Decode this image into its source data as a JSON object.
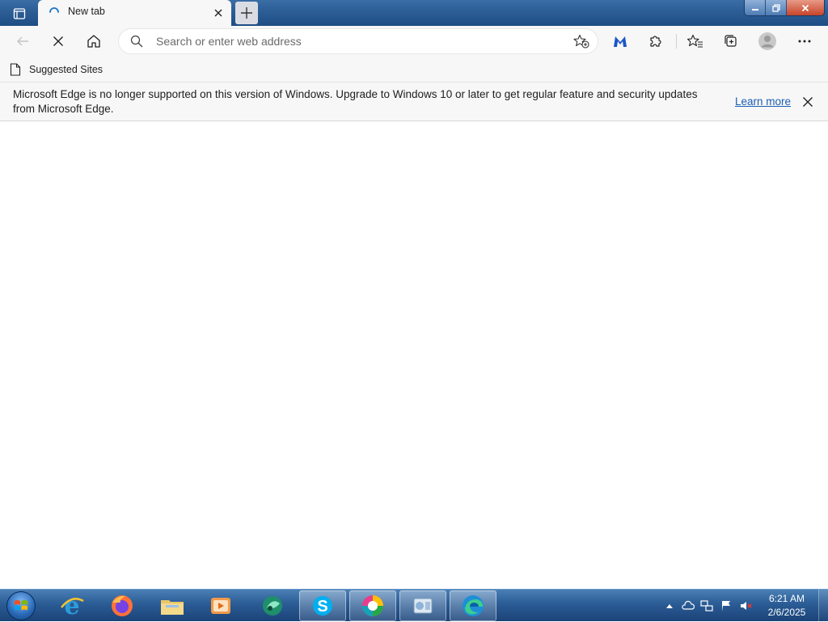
{
  "tab": {
    "title": "New tab",
    "state": "loading"
  },
  "address_bar": {
    "placeholder": "Search or enter web address",
    "value": ""
  },
  "favorites_bar": {
    "items": [
      {
        "label": "Suggested Sites",
        "icon": "page-icon"
      }
    ]
  },
  "infobar": {
    "message": "Microsoft Edge is no longer supported on this version of Windows. Upgrade to Windows 10 or later to get regular feature and security updates from Microsoft Edge.",
    "link": "Learn more"
  },
  "toolbar_icons": [
    "back-icon",
    "stop-icon",
    "home-icon",
    "favorites-add-icon",
    "malwarebytes-icon",
    "extensions-icon",
    "favorites-icon",
    "collections-icon",
    "profile-icon",
    "more-icon"
  ],
  "taskbar": {
    "apps": [
      "internet-explorer-icon",
      "firefox-icon",
      "file-explorer-icon",
      "media-player-icon",
      "app-icon",
      "skype-icon",
      "color-app-icon",
      "control-panel-icon",
      "edge-icon"
    ],
    "active_app": "edge-icon"
  },
  "clock": {
    "time": "6:21 AM",
    "date": "2/6/2025"
  },
  "colors": {
    "taskbar": "#2b5c95",
    "titlebar": "#2d5f97",
    "link": "#1a5fb4",
    "chrome": "#f7f7f7"
  }
}
